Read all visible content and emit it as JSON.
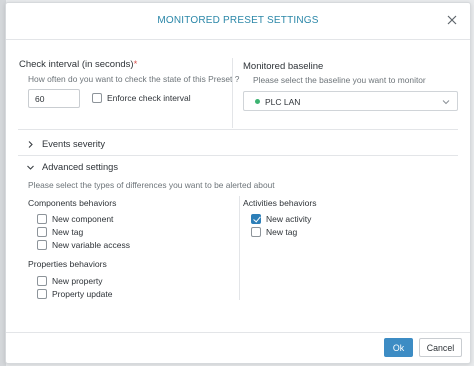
{
  "modal": {
    "title": "MONITORED PRESET SETTINGS"
  },
  "check_interval": {
    "label": "Check interval (in seconds)",
    "required_mark": "*",
    "hint": "How often do you want to check the state of this Preset ?",
    "value": "60",
    "enforce_label": "Enforce check interval",
    "enforce_checked": false
  },
  "baseline": {
    "label": "Monitored baseline",
    "hint": "Please select the baseline you want to monitor",
    "selected": "PLC LAN",
    "status_color": "#3cb371"
  },
  "events_severity": {
    "label": "Events severity",
    "expanded": false
  },
  "advanced": {
    "label": "Advanced settings",
    "expanded": true,
    "hint": "Please select the types of differences you want to be alerted about",
    "components": {
      "title": "Components behaviors",
      "items": [
        {
          "label": "New component",
          "checked": false
        },
        {
          "label": "New tag",
          "checked": false
        },
        {
          "label": "New variable access",
          "checked": false
        }
      ]
    },
    "properties": {
      "title": "Properties behaviors",
      "items": [
        {
          "label": "New property",
          "checked": false
        },
        {
          "label": "Property update",
          "checked": false
        }
      ]
    },
    "activities": {
      "title": "Activities behaviors",
      "items": [
        {
          "label": "New activity",
          "checked": true
        },
        {
          "label": "New tag",
          "checked": false
        }
      ]
    }
  },
  "footer": {
    "ok_label": "Ok",
    "cancel_label": "Cancel"
  },
  "colors": {
    "accent": "#2b87a8",
    "primary_button": "#3d8cc4",
    "checked": "#2d7fb8"
  }
}
